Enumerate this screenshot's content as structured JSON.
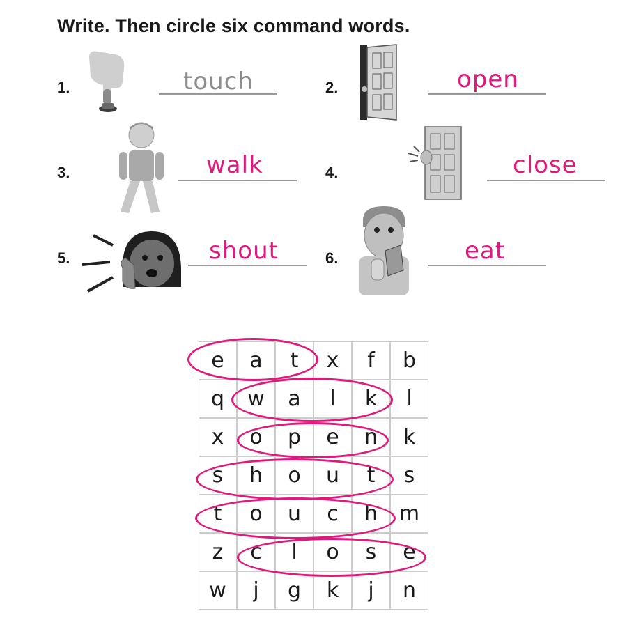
{
  "instruction": "Write. Then circle six command words.",
  "items": [
    {
      "number": "1.",
      "answer": "touch",
      "picture": "finger-pressing-button-icon"
    },
    {
      "number": "2.",
      "answer": "open",
      "picture": "open-door-icon"
    },
    {
      "number": "3.",
      "answer": "walk",
      "picture": "walking-boy-icon"
    },
    {
      "number": "4.",
      "answer": "close",
      "picture": "closing-door-icon"
    },
    {
      "number": "5.",
      "answer": "shout",
      "picture": "shouting-girl-icon"
    },
    {
      "number": "6.",
      "answer": "eat",
      "picture": "man-eating-sandwich-icon"
    }
  ],
  "colors": {
    "handwriting": "#e0197d",
    "example": "#8c8c8c",
    "grid": "#cccccc",
    "circle": "#e0197d"
  },
  "word_search": {
    "rows": [
      [
        "e",
        "a",
        "t",
        "x",
        "f",
        "b"
      ],
      [
        "q",
        "w",
        "a",
        "l",
        "k",
        "l"
      ],
      [
        "x",
        "o",
        "p",
        "e",
        "n",
        "k"
      ],
      [
        "s",
        "h",
        "o",
        "u",
        "t",
        "s"
      ],
      [
        "t",
        "o",
        "u",
        "c",
        "h",
        "m"
      ],
      [
        "z",
        "c",
        "l",
        "o",
        "s",
        "e"
      ],
      [
        "w",
        "j",
        "g",
        "k",
        "j",
        "n"
      ]
    ],
    "circled_words": [
      "eat",
      "walk",
      "open",
      "shout",
      "touch",
      "close"
    ]
  }
}
